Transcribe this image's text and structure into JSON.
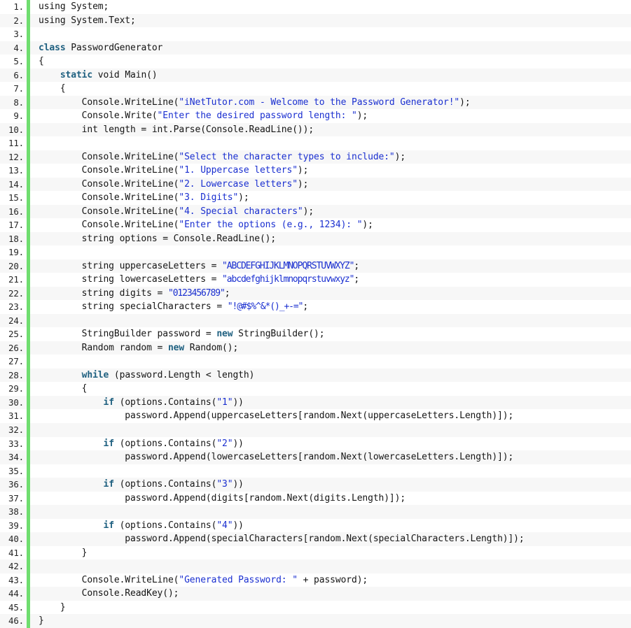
{
  "view": {
    "kind": "source-code-listing",
    "language": "C#",
    "total_lines": 46,
    "line_number_suffix": ".",
    "colors": {
      "background": "#ffffff",
      "row_alt_background": "#f7f7f7",
      "accent_bar": "#6fdd6f",
      "line_number": "#262626",
      "code_default": "#151515",
      "keyword": "#1f6080",
      "string": "#1a2fd0"
    }
  },
  "lines": [
    {
      "n": "1.",
      "tokens": [
        {
          "t": "using System;",
          "c": "plain"
        }
      ]
    },
    {
      "n": "2.",
      "tokens": [
        {
          "t": "using System.Text;",
          "c": "plain"
        }
      ]
    },
    {
      "n": "3.",
      "tokens": []
    },
    {
      "n": "4.",
      "tokens": [
        {
          "t": "class",
          "c": "kw"
        },
        {
          "t": " PasswordGenerator",
          "c": "plain"
        }
      ]
    },
    {
      "n": "5.",
      "tokens": [
        {
          "t": "{",
          "c": "plain"
        }
      ]
    },
    {
      "n": "6.",
      "tokens": [
        {
          "t": "    ",
          "c": "plain"
        },
        {
          "t": "static",
          "c": "kw"
        },
        {
          "t": " void Main()",
          "c": "plain"
        }
      ]
    },
    {
      "n": "7.",
      "tokens": [
        {
          "t": "    {",
          "c": "plain"
        }
      ]
    },
    {
      "n": "8.",
      "tokens": [
        {
          "t": "        Console.WriteLine(",
          "c": "plain"
        },
        {
          "t": "\"iNetTutor.com - Welcome to the Password Generator!\"",
          "c": "str"
        },
        {
          "t": ");",
          "c": "plain"
        }
      ]
    },
    {
      "n": "9.",
      "tokens": [
        {
          "t": "        Console.Write(",
          "c": "plain"
        },
        {
          "t": "\"Enter the desired password length: \"",
          "c": "str"
        },
        {
          "t": ");",
          "c": "plain"
        }
      ]
    },
    {
      "n": "10.",
      "tokens": [
        {
          "t": "        int length = int.Parse(Console.ReadLine());",
          "c": "plain"
        }
      ]
    },
    {
      "n": "11.",
      "tokens": []
    },
    {
      "n": "12.",
      "tokens": [
        {
          "t": "        Console.WriteLine(",
          "c": "plain"
        },
        {
          "t": "\"Select the character types to include:\"",
          "c": "str"
        },
        {
          "t": ");",
          "c": "plain"
        }
      ]
    },
    {
      "n": "13.",
      "tokens": [
        {
          "t": "        Console.WriteLine(",
          "c": "plain"
        },
        {
          "t": "\"1. Uppercase letters\"",
          "c": "str"
        },
        {
          "t": ");",
          "c": "plain"
        }
      ]
    },
    {
      "n": "14.",
      "tokens": [
        {
          "t": "        Console.WriteLine(",
          "c": "plain"
        },
        {
          "t": "\"2. Lowercase letters\"",
          "c": "str"
        },
        {
          "t": ");",
          "c": "plain"
        }
      ]
    },
    {
      "n": "15.",
      "tokens": [
        {
          "t": "        Console.WriteLine(",
          "c": "plain"
        },
        {
          "t": "\"3. Digits\"",
          "c": "str"
        },
        {
          "t": ");",
          "c": "plain"
        }
      ]
    },
    {
      "n": "16.",
      "tokens": [
        {
          "t": "        Console.WriteLine(",
          "c": "plain"
        },
        {
          "t": "\"4. Special characters\"",
          "c": "str"
        },
        {
          "t": ");",
          "c": "plain"
        }
      ]
    },
    {
      "n": "17.",
      "tokens": [
        {
          "t": "        Console.WriteLine(",
          "c": "plain"
        },
        {
          "t": "\"Enter the options (e.g., 1234): \"",
          "c": "str"
        },
        {
          "t": ");",
          "c": "plain"
        }
      ]
    },
    {
      "n": "18.",
      "tokens": [
        {
          "t": "        string options = Console.ReadLine();",
          "c": "plain"
        }
      ]
    },
    {
      "n": "19.",
      "tokens": []
    },
    {
      "n": "20.",
      "tokens": [
        {
          "t": "        string uppercaseLetters = ",
          "c": "plain"
        },
        {
          "t": "\"ABCDEFGHIJKLMNOPQRSTUVWXYZ\"",
          "c": "str-narrow"
        },
        {
          "t": ";",
          "c": "plain"
        }
      ]
    },
    {
      "n": "21.",
      "tokens": [
        {
          "t": "        string lowercaseLetters = ",
          "c": "plain"
        },
        {
          "t": "\"abcdefghijklmnopqrstuvwxyz\"",
          "c": "str-narrow"
        },
        {
          "t": ";",
          "c": "plain"
        }
      ]
    },
    {
      "n": "22.",
      "tokens": [
        {
          "t": "        string digits = ",
          "c": "plain"
        },
        {
          "t": "\"0123456789\"",
          "c": "str-narrow"
        },
        {
          "t": ";",
          "c": "plain"
        }
      ]
    },
    {
      "n": "23.",
      "tokens": [
        {
          "t": "        string specialCharacters = ",
          "c": "plain"
        },
        {
          "t": "\"!@#$%^&*()_+-=\"",
          "c": "str-narrow"
        },
        {
          "t": ";",
          "c": "plain"
        }
      ]
    },
    {
      "n": "24.",
      "tokens": []
    },
    {
      "n": "25.",
      "tokens": [
        {
          "t": "        StringBuilder password = ",
          "c": "plain"
        },
        {
          "t": "new",
          "c": "kw"
        },
        {
          "t": " StringBuilder();",
          "c": "plain"
        }
      ]
    },
    {
      "n": "26.",
      "tokens": [
        {
          "t": "        Random random = ",
          "c": "plain"
        },
        {
          "t": "new",
          "c": "kw"
        },
        {
          "t": " Random();",
          "c": "plain"
        }
      ]
    },
    {
      "n": "27.",
      "tokens": []
    },
    {
      "n": "28.",
      "tokens": [
        {
          "t": "        ",
          "c": "plain"
        },
        {
          "t": "while",
          "c": "kw"
        },
        {
          "t": " (password.Length < length)",
          "c": "plain"
        }
      ]
    },
    {
      "n": "29.",
      "tokens": [
        {
          "t": "        {",
          "c": "plain"
        }
      ]
    },
    {
      "n": "30.",
      "tokens": [
        {
          "t": "            ",
          "c": "plain"
        },
        {
          "t": "if",
          "c": "kw"
        },
        {
          "t": " (options.Contains(",
          "c": "plain"
        },
        {
          "t": "\"1\"",
          "c": "str"
        },
        {
          "t": "))",
          "c": "plain"
        }
      ]
    },
    {
      "n": "31.",
      "tokens": [
        {
          "t": "                password.Append(uppercaseLetters[random.Next(uppercaseLetters.Length)]);",
          "c": "plain"
        }
      ]
    },
    {
      "n": "32.",
      "tokens": []
    },
    {
      "n": "33.",
      "tokens": [
        {
          "t": "            ",
          "c": "plain"
        },
        {
          "t": "if",
          "c": "kw"
        },
        {
          "t": " (options.Contains(",
          "c": "plain"
        },
        {
          "t": "\"2\"",
          "c": "str"
        },
        {
          "t": "))",
          "c": "plain"
        }
      ]
    },
    {
      "n": "34.",
      "tokens": [
        {
          "t": "                password.Append(lowercaseLetters[random.Next(lowercaseLetters.Length)]);",
          "c": "plain"
        }
      ]
    },
    {
      "n": "35.",
      "tokens": []
    },
    {
      "n": "36.",
      "tokens": [
        {
          "t": "            ",
          "c": "plain"
        },
        {
          "t": "if",
          "c": "kw"
        },
        {
          "t": " (options.Contains(",
          "c": "plain"
        },
        {
          "t": "\"3\"",
          "c": "str"
        },
        {
          "t": "))",
          "c": "plain"
        }
      ]
    },
    {
      "n": "37.",
      "tokens": [
        {
          "t": "                password.Append(digits[random.Next(digits.Length)]);",
          "c": "plain"
        }
      ]
    },
    {
      "n": "38.",
      "tokens": []
    },
    {
      "n": "39.",
      "tokens": [
        {
          "t": "            ",
          "c": "plain"
        },
        {
          "t": "if",
          "c": "kw"
        },
        {
          "t": " (options.Contains(",
          "c": "plain"
        },
        {
          "t": "\"4\"",
          "c": "str"
        },
        {
          "t": "))",
          "c": "plain"
        }
      ]
    },
    {
      "n": "40.",
      "tokens": [
        {
          "t": "                password.Append(specialCharacters[random.Next(specialCharacters.Length)]);",
          "c": "plain"
        }
      ]
    },
    {
      "n": "41.",
      "tokens": [
        {
          "t": "        }",
          "c": "plain"
        }
      ]
    },
    {
      "n": "42.",
      "tokens": []
    },
    {
      "n": "43.",
      "tokens": [
        {
          "t": "        Console.WriteLine(",
          "c": "plain"
        },
        {
          "t": "\"Generated Password: \"",
          "c": "str"
        },
        {
          "t": " + password);",
          "c": "plain"
        }
      ]
    },
    {
      "n": "44.",
      "tokens": [
        {
          "t": "        Console.ReadKey();",
          "c": "plain"
        }
      ]
    },
    {
      "n": "45.",
      "tokens": [
        {
          "t": "    }",
          "c": "plain"
        }
      ]
    },
    {
      "n": "46.",
      "tokens": [
        {
          "t": "}",
          "c": "plain"
        }
      ]
    }
  ]
}
